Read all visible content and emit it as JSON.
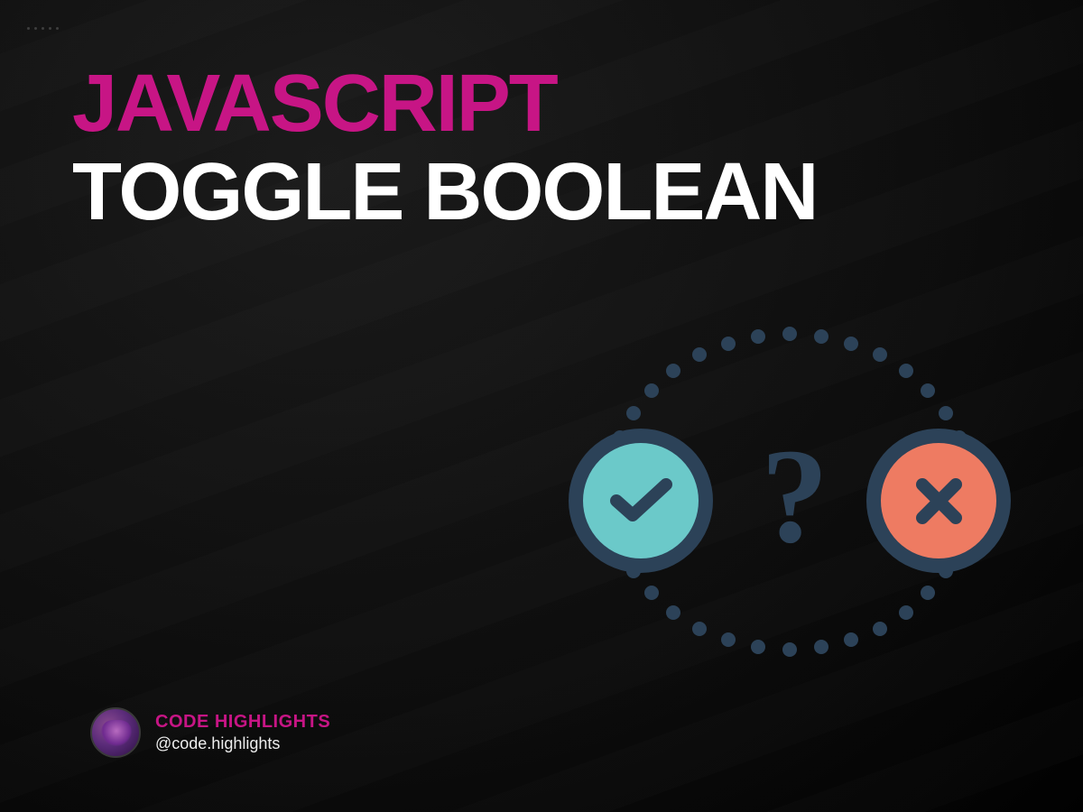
{
  "heading": {
    "line1": "JAVASCRIPT",
    "line2": "TOGGLE BOOLEAN"
  },
  "illustration": {
    "question_symbol": "?",
    "check_icon_name": "check-icon",
    "cross_icon_name": "cross-icon",
    "ring_color": "#2C4258",
    "check_fill": "#6BC9C9",
    "cross_fill": "#EE7B62"
  },
  "author": {
    "brand": "CODE HIGHLIGHTS",
    "handle": "@code.highlights"
  },
  "colors": {
    "accent_pink": "#C71585",
    "text_white": "#FFFFFF",
    "dark_navy": "#2C4258"
  }
}
